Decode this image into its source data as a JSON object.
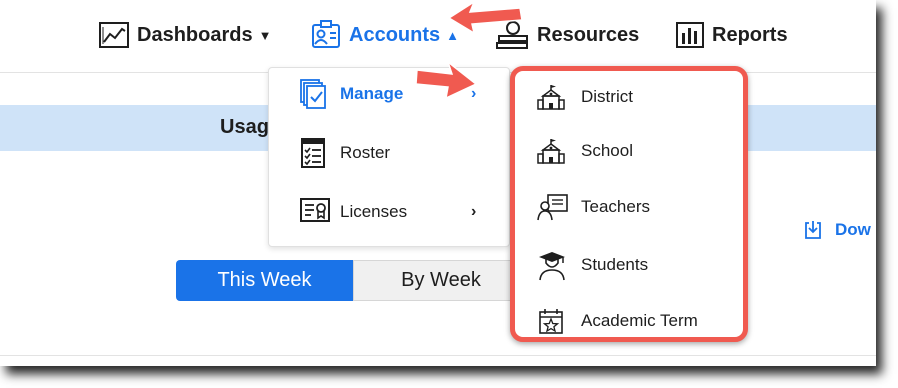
{
  "nav": {
    "dashboards": "Dashboards",
    "accounts": "Accounts",
    "resources": "Resources",
    "reports": "Reports"
  },
  "page": {
    "usage_title": "Usag",
    "download_label": "Dow"
  },
  "range_toggle": {
    "this_week": "This Week",
    "by_week": "By Week"
  },
  "accounts_menu": {
    "items": [
      {
        "label": "Manage",
        "icon": "manage-icon",
        "has_submenu": true,
        "active": true
      },
      {
        "label": "Roster",
        "icon": "roster-icon",
        "has_submenu": false
      },
      {
        "label": "Licenses",
        "icon": "licenses-icon",
        "has_submenu": true
      }
    ]
  },
  "manage_submenu": {
    "items": [
      {
        "label": "District",
        "icon": "school-building-icon"
      },
      {
        "label": "School",
        "icon": "school-building-icon"
      },
      {
        "label": "Teachers",
        "icon": "teacher-icon"
      },
      {
        "label": "Students",
        "icon": "student-icon"
      },
      {
        "label": "Academic Term",
        "icon": "calendar-icon"
      }
    ]
  },
  "colors": {
    "accent": "#1a73e8",
    "highlight_border": "#f05a50",
    "annotation_arrow": "#f05a50",
    "banner": "#cfe3f8"
  }
}
